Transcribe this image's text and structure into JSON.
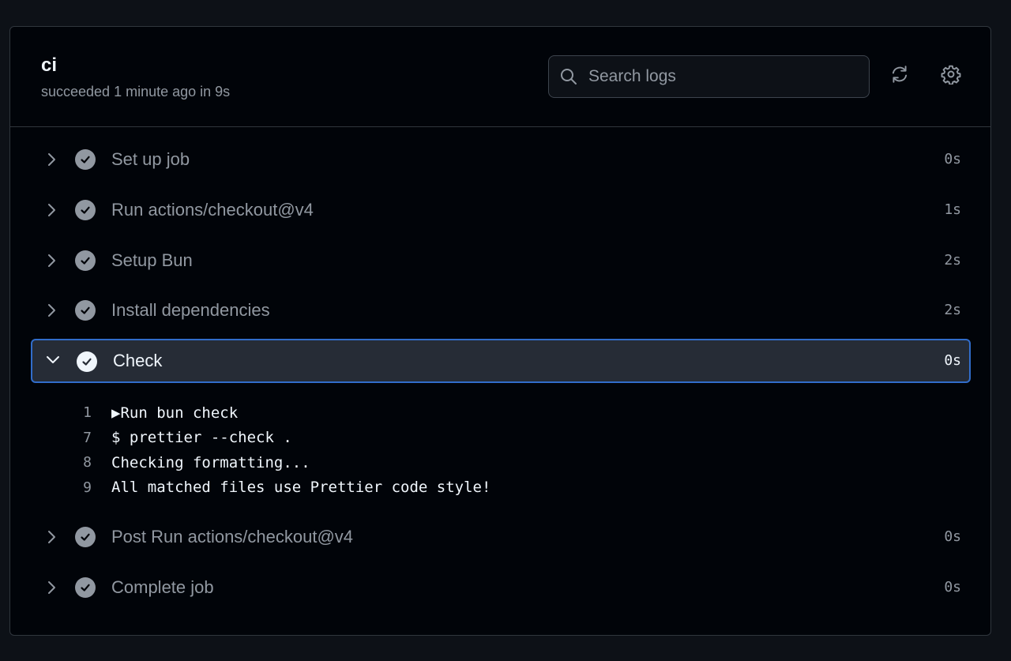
{
  "job": {
    "title": "ci",
    "status": "succeeded 1 minute ago in 9s"
  },
  "search": {
    "placeholder": "Search logs",
    "value": ""
  },
  "icons": {
    "search": "search-icon",
    "refresh": "refresh-icon",
    "settings": "gear-icon",
    "expand": "chevron-right-icon",
    "collapse": "chevron-down-icon",
    "success": "check-circle-icon"
  },
  "colors": {
    "background": "#0d1117",
    "panel": "#010409",
    "border": "#30363d",
    "active_step_bg": "#262c36",
    "active_step_border": "#316dca",
    "muted_text": "#9198a1",
    "primary_text": "#f0f6fc"
  },
  "steps": [
    {
      "name": "Set up job",
      "duration": "0s",
      "expanded": false
    },
    {
      "name": "Run actions/checkout@v4",
      "duration": "1s",
      "expanded": false
    },
    {
      "name": "Setup Bun",
      "duration": "2s",
      "expanded": false
    },
    {
      "name": "Install dependencies",
      "duration": "2s",
      "expanded": false
    },
    {
      "name": "Check",
      "duration": "0s",
      "expanded": true
    },
    {
      "name": "Post Run actions/checkout@v4",
      "duration": "0s",
      "expanded": false
    },
    {
      "name": "Complete job",
      "duration": "0s",
      "expanded": false
    }
  ],
  "log": [
    {
      "line": "1",
      "text": "▶Run bun check"
    },
    {
      "line": "7",
      "text": "$ prettier --check ."
    },
    {
      "line": "8",
      "text": "Checking formatting..."
    },
    {
      "line": "9",
      "text": "All matched files use Prettier code style!"
    }
  ]
}
